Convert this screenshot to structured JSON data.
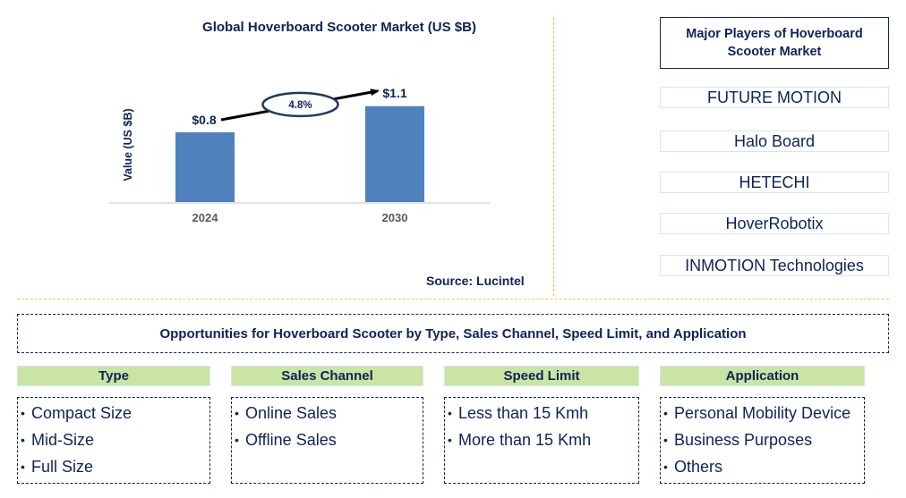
{
  "chart_data": {
    "type": "bar",
    "title": "Global Hoverboard Scooter Market (US $B)",
    "xlabel": "",
    "ylabel": "Value (US $B)",
    "categories": [
      "2024",
      "2030"
    ],
    "values": [
      0.8,
      1.1
    ],
    "data_labels": [
      "$0.8",
      "$1.1"
    ],
    "ylim": [
      0,
      1.4
    ],
    "grid": false,
    "bar_color": "#4f81bd",
    "annotation": {
      "type": "cagr-arrow",
      "label": "4.8%",
      "from": "2024",
      "to": "2030"
    }
  },
  "source": "Source: Lucintel",
  "players": {
    "title": "Major Players of Hoverboard Scooter Market",
    "items": [
      "FUTURE MOTION",
      "Halo Board",
      "HETECHI",
      "HoverRobotix",
      "INMOTION Technologies"
    ]
  },
  "opportunities": {
    "title": "Opportunities for Hoverboard Scooter by Type, Sales Channel, Speed Limit, and Application",
    "categories": [
      {
        "header": "Type",
        "items": [
          "Compact Size",
          "Mid-Size",
          "Full Size"
        ]
      },
      {
        "header": "Sales Channel",
        "items": [
          "Online Sales",
          "Offline Sales"
        ]
      },
      {
        "header": "Speed Limit",
        "items": [
          "Less than 15 Kmh",
          "More than 15 Kmh"
        ]
      },
      {
        "header": "Application",
        "items": [
          "Personal Mobility Device",
          "Business Purposes",
          "Others"
        ]
      }
    ]
  },
  "colors": {
    "text": "#0d2359",
    "bar": "#4f81bd",
    "category_header_bg": "#c9e4a3",
    "divider": "#f5b820"
  }
}
